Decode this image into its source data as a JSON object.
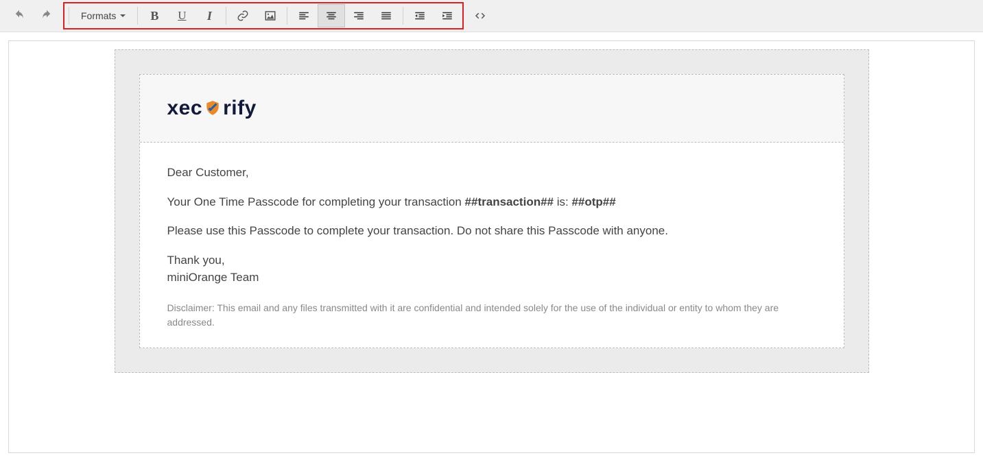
{
  "toolbar": {
    "formats_label": "Formats"
  },
  "logo": {
    "part1": "xec",
    "part2": "rify"
  },
  "email": {
    "greeting": "Dear Customer,",
    "line1_a": "Your One Time Passcode for completing your transaction ",
    "line1_bold1": "##transaction##",
    "line1_mid": " is: ",
    "line1_bold2": "##otp##",
    "line2": "Please use this Passcode to complete your transaction. Do not share this Passcode with anyone.",
    "thanks_a": "Thank you,",
    "thanks_b": "miniOrange Team",
    "disclaimer": "Disclaimer: This email and any files transmitted with it are confidential and intended solely for the use of the individual or entity to whom they are addressed."
  }
}
